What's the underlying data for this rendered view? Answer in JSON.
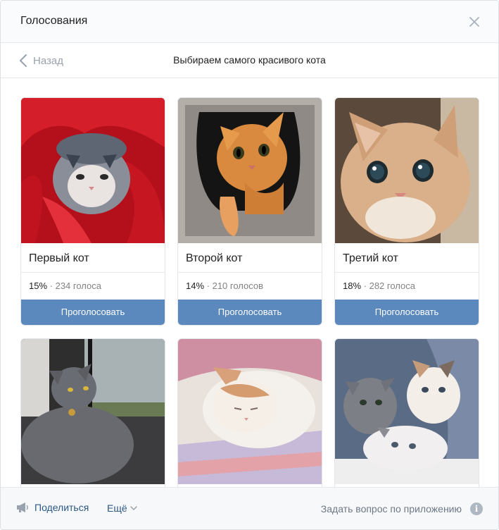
{
  "window": {
    "title": "Голосования"
  },
  "nav": {
    "back_label": "Назад",
    "poll_title": "Выбираем самого красивого кота"
  },
  "poll": {
    "vote_label": "Проголосовать",
    "options": [
      {
        "name": "Первый кот",
        "percent": "15%",
        "votes": "234 голоса",
        "votes_pct": 15
      },
      {
        "name": "Второй кот",
        "percent": "14%",
        "votes": "210 голосов",
        "votes_pct": 14
      },
      {
        "name": "Третий кот",
        "percent": "18%",
        "votes": "282 голоса",
        "votes_pct": 18
      }
    ],
    "photos": [
      "cat-in-red-blanket",
      "ginger-cat-in-felt-house",
      "ginger-cat-big-eyes",
      "grey-cat-on-window",
      "white-cat-sleeping",
      "three-kittens"
    ]
  },
  "footer": {
    "share_label": "Поделиться",
    "more_label": "Ещё",
    "ask_label": "Задать вопрос по приложению",
    "info_icon_glyph": "i"
  },
  "colors": {
    "accent_button": "#5b88bd",
    "link": "#2a5885",
    "muted": "#828282"
  }
}
